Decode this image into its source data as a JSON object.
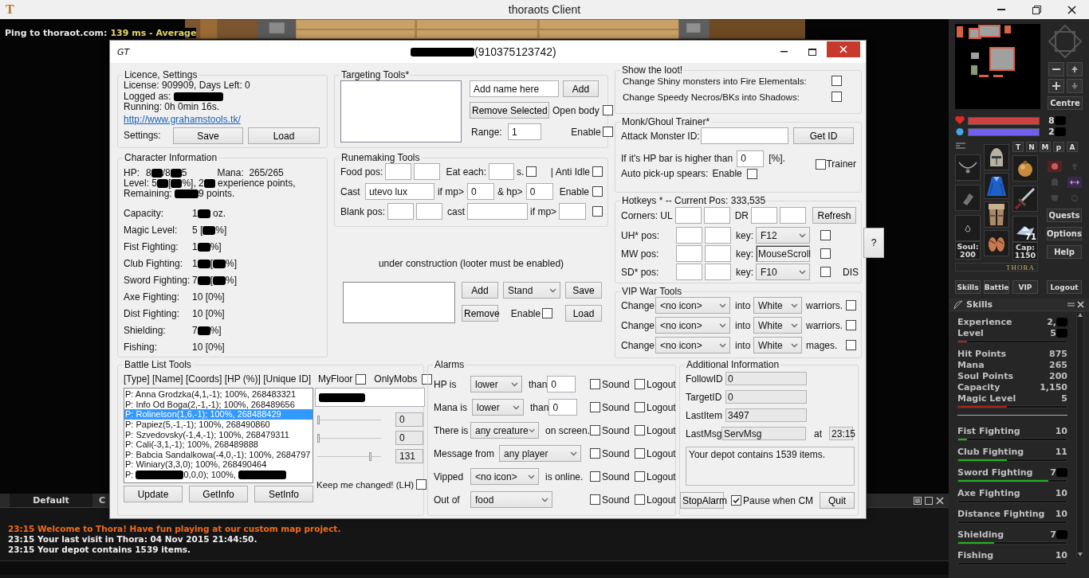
{
  "window": {
    "icon_text": "T",
    "title": "thoraots Client"
  },
  "game": {
    "ping_label": "Ping to thoraot.com:",
    "ping_value": "139 ms - Average"
  },
  "dialog": {
    "icon_text": "GT",
    "title": [
      {
        "kind": "redacted"
      },
      "(910375123742)"
    ],
    "licence": {
      "title": "Licence, Settings",
      "license": "License: 909909, Days Left: 0",
      "logged_label": "Logged as:",
      "running": "Running: 0h 0min 16s.",
      "link": "http://www.grahamstools.tk/",
      "settings_label": "Settings:",
      "save": "Save",
      "load": "Load"
    },
    "character": {
      "title": "Character Information",
      "hp_label": "HP:",
      "hp": [
        "8",
        {
          "kind": "redacted"
        },
        "/8",
        {
          "kind": "redacted"
        },
        "5"
      ],
      "mana_label": "Mana:",
      "mana": "265/265",
      "level": [
        "Level: 5",
        {
          "kind": "redacted"
        },
        "[",
        {
          "kind": "redacted"
        },
        "%], 2",
        {
          "kind": "redacted"
        },
        " experience points,"
      ],
      "remaining": [
        "Remaining: ",
        {
          "kind": "redacted"
        },
        "9 points."
      ],
      "skills": [
        {
          "label": "Capacity:",
          "value": [
            "1",
            {
              "kind": "redacted"
            },
            " oz."
          ]
        },
        {
          "label": "Magic Level:",
          "value": [
            "5 [",
            {
              "kind": "redacted"
            },
            "%]"
          ]
        },
        {
          "label": "Fist Fighting:",
          "value": [
            "1",
            {
              "kind": "redacted"
            },
            "%]"
          ]
        },
        {
          "label": "Club Fighting:",
          "value": [
            "1",
            {
              "kind": "redacted"
            },
            "[",
            {
              "kind": "redacted"
            },
            "%]"
          ]
        },
        {
          "label": "Sword Fighting:",
          "value": [
            "7",
            {
              "kind": "redacted"
            },
            "[",
            {
              "kind": "redacted"
            },
            "%]"
          ]
        },
        {
          "label": "Axe Fighting:",
          "value": [
            "10 [0%]"
          ]
        },
        {
          "label": "Dist Fighting:",
          "value": [
            "10 [0%]"
          ]
        },
        {
          "label": "Shielding:",
          "value": [
            "7",
            {
              "kind": "redacted"
            },
            "%]"
          ]
        },
        {
          "label": "Fishing:",
          "value": [
            "10 [0%]"
          ]
        }
      ]
    },
    "targeting": {
      "title": "Targeting Tools*",
      "name_value": "Add name here",
      "add": "Add",
      "remove": "Remove Selected",
      "open_body": {
        "label": "Open body",
        "checked": false
      },
      "range_label": "Range:",
      "range": "1",
      "enable": {
        "label": "Enable",
        "checked": false
      }
    },
    "runemaking": {
      "title": "Runemaking Tools",
      "food_label": "Food pos:",
      "eat_label": "Eat each:",
      "eat_unit": "s.",
      "eat_checked": false,
      "anti_idle": {
        "label": "| Anti Idle",
        "checked": false
      },
      "cast_label": "Cast",
      "cast_value": "utevo lux",
      "mp_label": "if mp>",
      "mp_value": "0",
      "hp_label": "& hp>",
      "hp_value": "0",
      "enable": {
        "label": "Enable",
        "checked": false
      },
      "blank_label": "Blank pos:",
      "blank_cast_label": "cast",
      "blank_mp_label": "if mp>",
      "blank_checked": false
    },
    "looter": {
      "note": "under construction (looter must be enabled)",
      "add": "Add",
      "mode": "Stand",
      "save": "Save",
      "remove": "Remove",
      "enable": {
        "label": "Enable",
        "checked": false
      },
      "load": "Load"
    },
    "loot": {
      "title": "Show the loot!",
      "options": [
        {
          "label": "Change Shiny monsters into Fire Elementals:",
          "checked": false
        },
        {
          "label": "Change Speedy Necros/BKs into Shadows:",
          "checked": false
        }
      ]
    },
    "trainer": {
      "title": "Monk/Ghoul Trainer*",
      "attack_label": "Attack Monster ID:",
      "get_id": "Get ID",
      "hp_label": "If it's HP bar is higher than",
      "hp_value": "0",
      "hp_unit": "[%].",
      "trainer": {
        "label": "Trainer",
        "checked": false
      },
      "spears_label": "Auto pick-up spears:",
      "spears": {
        "label": "Enable",
        "checked": false
      }
    },
    "hotkeys": {
      "title": "Hotkeys * -- Current Pos: 333,535",
      "corners_label": "Corners: UL",
      "dr_label": "DR",
      "refresh": "Refresh",
      "help": "?",
      "rows": [
        {
          "label": "UH* pos:",
          "key_label": "key:",
          "key": "F12",
          "kind": "select",
          "checked": false
        },
        {
          "label": "MW pos:",
          "key_label": "key:",
          "key": "MouseScroll",
          "kind": "field",
          "checked": false
        },
        {
          "label": "SD* pos:",
          "key_label": "key:",
          "key": "F10",
          "kind": "select",
          "checked": false,
          "after": "DIS"
        }
      ]
    },
    "vip": {
      "title": "VIP War Tools",
      "rows": [
        {
          "label": "Change",
          "icon": "<no icon>",
          "into": "into",
          "tint": "White",
          "target": "warriors.",
          "checked": false
        },
        {
          "label": "Change",
          "icon": "<no icon>",
          "into": "into",
          "tint": "White",
          "target": "warriors.",
          "checked": false
        },
        {
          "label": "Change",
          "icon": "<no icon>",
          "into": "into",
          "tint": "White",
          "target": "mages.",
          "checked": false
        }
      ]
    },
    "battle": {
      "title": "Battle List Tools",
      "header": "[Type] [Name] [Coords] [HP (%)] [Unique ID]",
      "myfloor": {
        "label": "MyFloor",
        "checked": false
      },
      "onlymobs": {
        "label": "OnlyMobs",
        "checked": false
      },
      "entries": [
        {
          "parts": [
            "P: Anna Grodzka(4,1,-1); 100%, 268483321"
          ],
          "selected": false
        },
        {
          "parts": [
            "P: Info Od Boga(2,-1,-1); 100%, 268489656"
          ],
          "selected": false
        },
        {
          "parts": [
            "P: Rolinelson(1,6,-1); 100%, 268488429"
          ],
          "selected": true
        },
        {
          "parts": [
            "P: Papiez(5,-1,-1); 100%, 268490860"
          ],
          "selected": false
        },
        {
          "parts": [
            "P: Szvedovsky(-1,4,-1); 100%, 268479311"
          ],
          "selected": false
        },
        {
          "parts": [
            "P: Cali(-3,1,-1); 100%, 268489888"
          ],
          "selected": false
        },
        {
          "parts": [
            "P: Babcia Sandalkowa(-4,0,-1); 100%, 2684797"
          ],
          "selected": false
        },
        {
          "parts": [
            "P: Winiary(3,3,0); 100%, 268490464"
          ],
          "selected": false
        },
        {
          "parts": [
            "P: ",
            {
              "kind": "redacted"
            },
            "0,0,0); 100%, ",
            {
              "kind": "redacted"
            }
          ],
          "selected": false
        }
      ],
      "sliders": [
        {
          "level": 0,
          "value": "0"
        },
        {
          "level": 0,
          "value": "0"
        },
        {
          "level": 0.85,
          "value": "131"
        }
      ],
      "keep": {
        "label": "Keep me changed! (LH)",
        "checked": false
      },
      "buttons": [
        "Update",
        "GetInfo",
        "SetInfo"
      ]
    },
    "alarms": {
      "title": "Alarms",
      "rows": [
        {
          "label": "HP is",
          "choice": "lower",
          "after": "than",
          "value": "0",
          "sound": {
            "label": "Sound",
            "checked": false
          },
          "logout": {
            "label": "Logout",
            "checked": false
          }
        },
        {
          "label": "Mana is",
          "choice": "lower",
          "after": "than",
          "value": "0",
          "sound": {
            "label": "Sound",
            "checked": false
          },
          "logout": {
            "label": "Logout",
            "checked": false
          }
        },
        {
          "label": "There is",
          "choice": "any creature",
          "after": "on screen.",
          "sound": {
            "label": "Sound",
            "checked": false
          },
          "logout": {
            "label": "Logout",
            "checked": false
          }
        },
        {
          "label": "Message from",
          "choice": "any player",
          "sound": {
            "label": "Sound",
            "checked": false
          },
          "logout": {
            "label": "Logout",
            "checked": false
          }
        },
        {
          "label": "Vipped",
          "choice": "<no icon>",
          "after": "is online.",
          "sound": {
            "label": "Sound",
            "checked": false
          },
          "logout": {
            "label": "Logout",
            "checked": false
          }
        },
        {
          "label": "Out of",
          "choice": "food",
          "sound": {
            "label": "Sound",
            "checked": false
          },
          "logout": {
            "label": "Logout",
            "checked": false
          }
        }
      ]
    },
    "info": {
      "title": "Additional Information",
      "fields": [
        {
          "label": "FollowID",
          "value": "0"
        },
        {
          "label": "TargetID",
          "value": "0"
        },
        {
          "label": "LastItem",
          "value": "3497"
        },
        {
          "label": "LastMsg",
          "value": "ServMsg"
        }
      ],
      "at_label": "at",
      "at_value": "23:15",
      "message": "Your depot contains 1539 items.",
      "stop": "StopAlarm",
      "pause": {
        "label": "Pause when CM",
        "checked": true
      },
      "quit": "Quit"
    }
  },
  "sidebar": {
    "centre": "Centre",
    "health": {
      "level": 1,
      "value": [
        "8",
        {
          "kind": "redacted"
        }
      ]
    },
    "mana": {
      "level": 1,
      "value": [
        "2",
        {
          "kind": "redacted"
        }
      ]
    },
    "modes": [
      "T",
      "N",
      "M",
      "p",
      "A"
    ],
    "soul_label": "Soul:",
    "soul": "200",
    "ammo_count": "71",
    "cap_label": "Cap:",
    "cap": "1150",
    "logo": "THORA",
    "menu": [
      "Quests",
      "Options",
      "Help"
    ],
    "buttons": [
      "Skills",
      "Battle",
      "VIP",
      "Logout"
    ],
    "skills_title": "Skills",
    "stats": [
      {
        "label": "Experience",
        "value": [
          "2,",
          {
            "kind": "redacted"
          }
        ]
      },
      {
        "label": "Level",
        "value": [
          "5",
          {
            "kind": "redacted"
          }
        ],
        "level": 0.08
      },
      {
        "label": "Hit Points",
        "value": [
          "875"
        ]
      },
      {
        "label": "Mana",
        "value": [
          "265"
        ]
      },
      {
        "label": "Soul Points",
        "value": [
          "200"
        ]
      },
      {
        "label": "Capacity",
        "value": [
          "1,150"
        ]
      },
      {
        "label": "Magic Level",
        "value": [
          "5"
        ],
        "level": 0.45
      }
    ],
    "skills": [
      {
        "label": "Fist Fighting",
        "value": [
          "10"
        ],
        "level": 0.08
      },
      {
        "label": "Club Fighting",
        "value": [
          "11"
        ],
        "level": 0.45
      },
      {
        "label": "Sword Fighting",
        "value": [
          "7",
          {
            "kind": "redacted"
          }
        ],
        "level": 0.83
      },
      {
        "label": "Axe Fighting",
        "value": [
          "10"
        ]
      },
      {
        "label": "Distance Fighting",
        "value": [
          "10"
        ]
      },
      {
        "label": "Shielding",
        "value": [
          "7",
          {
            "kind": "redacted"
          }
        ],
        "level": 0.33
      },
      {
        "label": "Fishing",
        "value": [
          "10"
        ]
      }
    ]
  },
  "chat": {
    "tabs": [
      {
        "label": "Default",
        "selected": true
      },
      {
        "label": "C",
        "selected": false
      }
    ],
    "messages": [
      {
        "kind": "notice",
        "text": "23:15 Welcome to Thora! Have fun playing at our custom map project."
      },
      {
        "kind": "info",
        "text": "23:15 Your last visit in Thora: 04 Nov 2015 21:44:50."
      },
      {
        "kind": "info",
        "text": "23:15 Your depot contains 1539 items."
      }
    ]
  }
}
